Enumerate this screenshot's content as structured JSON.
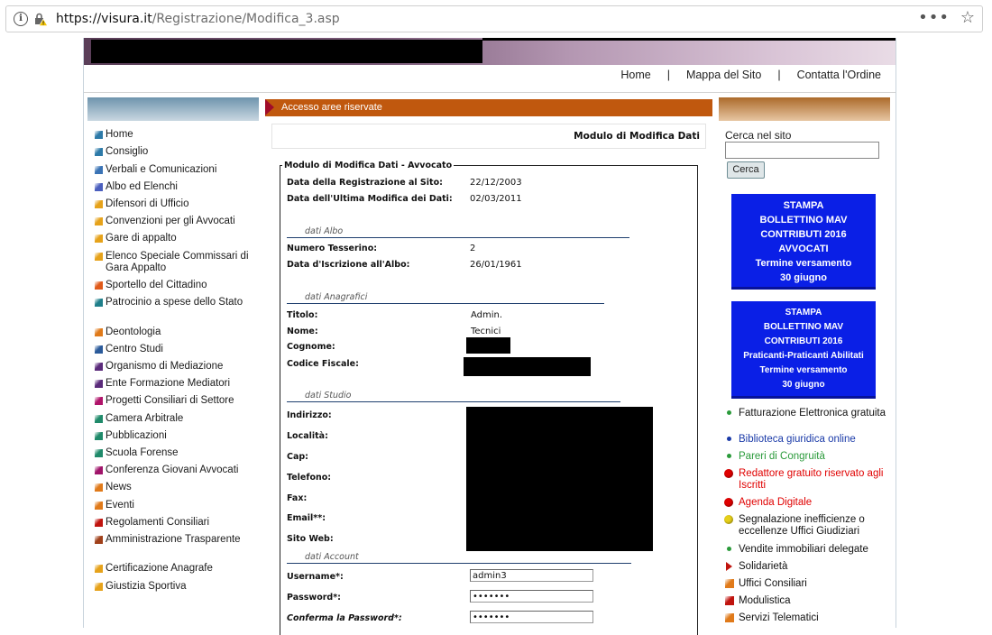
{
  "browser": {
    "url_domain": "https://visura.it",
    "url_path": "/Registrazione/Modifica_3.asp",
    "menu_icon": "more-icon",
    "bookmark_icon": "star-icon"
  },
  "topnav": {
    "items": [
      "Home",
      "Mappa del Sito",
      "Contatta l'Ordine"
    ],
    "separator": "|"
  },
  "leftnav": {
    "items": [
      {
        "label": "Home",
        "color": "#2d7aa8"
      },
      {
        "label": "Consiglio",
        "color": "#2d7aa8"
      },
      {
        "label": "Verbali e Comunicazioni",
        "color": "#3a73b5"
      },
      {
        "label": "Albo ed Elenchi",
        "color": "#4b5fbe"
      },
      {
        "label": "Difensori di Ufficio",
        "color": "#e6a21a"
      },
      {
        "label": "Convenzioni per gli Avvocati",
        "color": "#e6a21a"
      },
      {
        "label": "Gare di appalto",
        "color": "#e6a21a"
      },
      {
        "label": "Elenco Speciale Commissari di Gara Appalto",
        "color": "#e6a21a"
      },
      {
        "label": "Sportello del Cittadino",
        "color": "#e05a1a"
      },
      {
        "label": "Patrocinio a spese dello Stato",
        "color": "#1f7f8a"
      },
      {
        "label": "Deontologia",
        "color": "#e07a1a"
      },
      {
        "label": "Centro Studi",
        "color": "#2a5a9a"
      },
      {
        "label": "Organismo di Mediazione",
        "color": "#5a2a7a"
      },
      {
        "label": "Ente Formazione Mediatori",
        "color": "#5a2a7a"
      },
      {
        "label": "Progetti Consiliari di Settore",
        "color": "#b0146a"
      },
      {
        "label": "Camera Arbitrale",
        "color": "#1f8a6a"
      },
      {
        "label": "Pubblicazioni",
        "color": "#1f8a6a"
      },
      {
        "label": "Scuola Forense",
        "color": "#1f8a6a"
      },
      {
        "label": "Conferenza Giovani Avvocati",
        "color": "#a0146a"
      },
      {
        "label": "News",
        "color": "#e07a1a"
      },
      {
        "label": "Eventi",
        "color": "#e07a1a"
      },
      {
        "label": "Regolamenti Consiliari",
        "color": "#c0140e"
      },
      {
        "label": "Amministrazione Trasparente",
        "color": "#a0401a"
      },
      {
        "label": "Certificazione Anagrafe",
        "color": "#e6a21a"
      },
      {
        "label": "Giustizia Sportiva",
        "color": "#e6a21a"
      }
    ]
  },
  "center": {
    "access_bar": "Accesso aree riservate",
    "module_title": "Modulo di Modifica Dati",
    "legend": "Modulo di Modifica Dati - Avvocato",
    "reg_date_label": "Data della Registrazione al Sito:",
    "reg_date": "22/12/2003",
    "mod_date_label": "Data dell'Ultima Modifica dei Dati:",
    "mod_date": "02/03/2011",
    "sect_albo": "dati Albo",
    "tessera_label": "Numero Tesserino:",
    "tessera": "2",
    "iscr_label": "Data d'Iscrizione all'Albo:",
    "iscr": "26/01/1961",
    "sect_anagrafici": "dati Anagrafici",
    "titolo_label": "Titolo:",
    "titolo": "Admin.",
    "nome_label": "Nome:",
    "nome": "Tecnici",
    "cognome_label": "Cognome:",
    "cf_label": "Codice Fiscale:",
    "sect_studio": "dati Studio",
    "indirizzo_label": "Indirizzo:",
    "localita_label": "Località:",
    "cap_label": "Cap:",
    "telefono_label": "Telefono:",
    "fax_label": "Fax:",
    "email_label": "Email**:",
    "sito_label": "Sito Web:",
    "sect_account": "dati Account",
    "username_label": "Username*:",
    "username": "admin3",
    "password_label": "Password*:",
    "password": "•••••••",
    "confirm_label": "Conferma la Password*:",
    "confirm": "•••••••"
  },
  "right": {
    "search_label": "Cerca nel sito",
    "search_value": "",
    "search_button": "Cerca",
    "mav1": [
      "STAMPA",
      "BOLLETTINO MAV",
      "CONTRIBUTI 2016",
      "AVVOCATI",
      "Termine versamento",
      "30 giugno"
    ],
    "mav2": [
      "STAMPA",
      "BOLLETTINO MAV",
      "CONTRIBUTI 2016",
      "Praticanti-Praticanti Abilitati",
      "Termine versamento",
      "30 giugno"
    ],
    "mav_color": "#0a1fe6",
    "links": [
      {
        "label": "Fatturazione Elettronica gratuita",
        "color": "#111111",
        "marker": "dot",
        "marker_color": "#2a9a3a"
      },
      {
        "label": "Biblioteca giuridica online",
        "color": "#1a3aa8",
        "marker": "dot",
        "marker_color": "#1a3aa8"
      },
      {
        "label": "Pareri di Congruità",
        "color": "#2a9a3a",
        "marker": "dot",
        "marker_color": "#2a9a3a"
      },
      {
        "label": "Redattore gratuito riservato agli Iscritti",
        "color": "#e00000",
        "marker": "bigdot",
        "marker_color": "#e00000"
      },
      {
        "label": "Agenda Digitale",
        "color": "#e00000",
        "marker": "bigdot",
        "marker_color": "#e00000"
      },
      {
        "label": "Segnalazione inefficienze o eccellenze Uffici Giudiziari",
        "color": "#111111",
        "marker": "bigdot",
        "marker_color": "#e6d01a"
      },
      {
        "label": "Vendite immobiliari delegate",
        "color": "#111111",
        "marker": "dot",
        "marker_color": "#2a9a3a"
      },
      {
        "label": "Solidarietà",
        "color": "#111111",
        "marker": "tri",
        "marker_color": "#c0140e"
      },
      {
        "label": "Uffici Consiliari",
        "color": "#111111",
        "marker": "sq",
        "marker_color": "#e07a1a"
      },
      {
        "label": "Modulistica",
        "color": "#111111",
        "marker": "sq",
        "marker_color": "#c0140e"
      },
      {
        "label": "Servizi Telematici",
        "color": "#111111",
        "marker": "sq",
        "marker_color": "#e07a1a"
      }
    ]
  }
}
